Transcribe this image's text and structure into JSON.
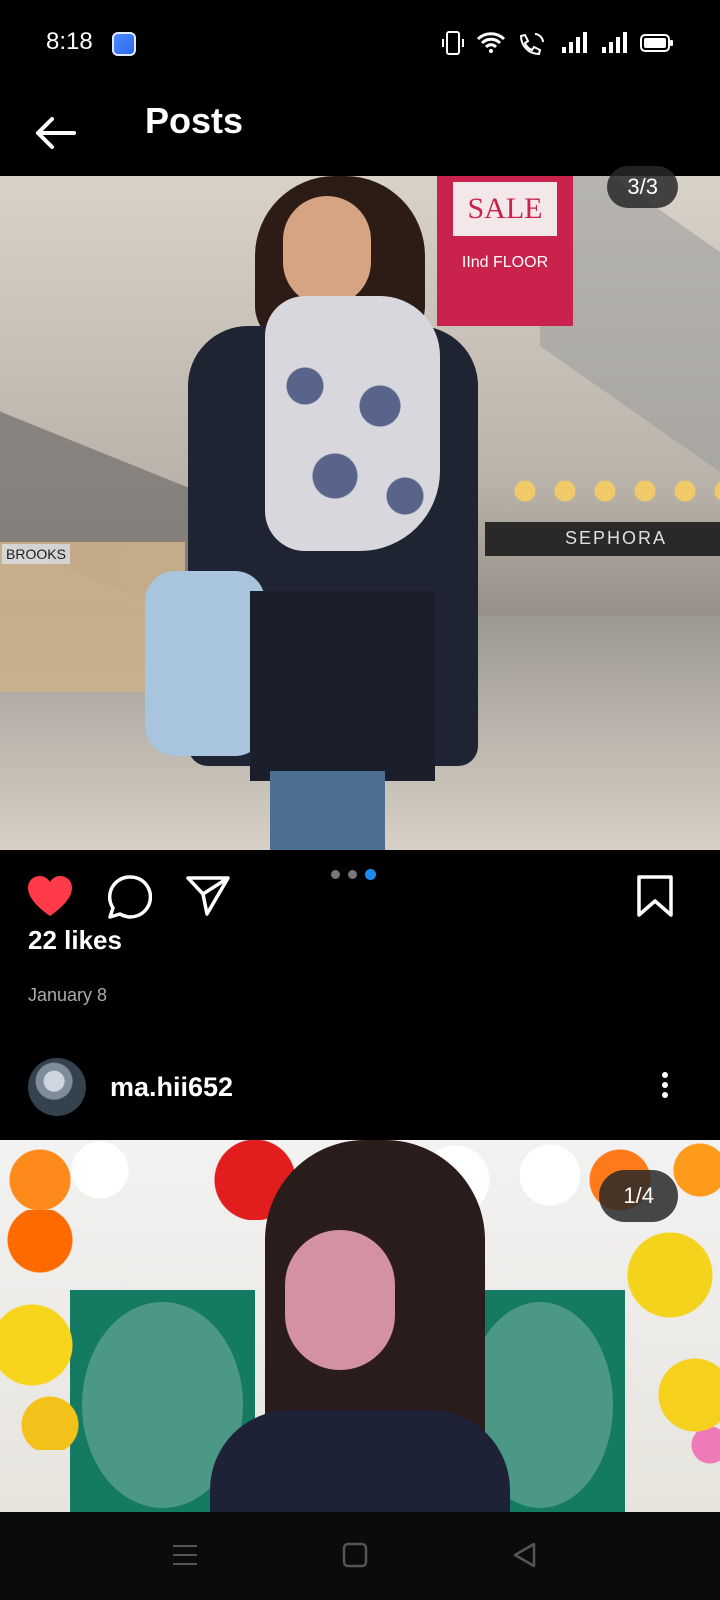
{
  "status_bar": {
    "time": "8:18",
    "icons": [
      "app-notification-icon",
      "vibrate-icon",
      "wifi-icon",
      "wifi-calling-icon",
      "signal-icon-1",
      "signal-icon-2",
      "battery-icon"
    ]
  },
  "header": {
    "back_icon": "arrow-left-icon",
    "title": "Posts"
  },
  "post1": {
    "photo_counter": "3/3",
    "photo_signage": {
      "sale_text": "SALE",
      "floor_text": "IInd FLOOR",
      "store_name_right": "SEPHORA",
      "store_name_left": "BROOKS"
    },
    "actions": {
      "like_icon": "heart-filled-icon",
      "comment_icon": "comment-bubble-icon",
      "share_icon": "send-paper-plane-icon",
      "save_icon": "bookmark-icon"
    },
    "carousel": {
      "total": 3,
      "active_index": 3
    },
    "likes": "22 likes",
    "date": "January 8"
  },
  "post2": {
    "username": "ma.hii652",
    "avatar_icon": "user-avatar",
    "more_icon": "more-vertical-icon",
    "photo_counter": "1/4"
  },
  "navigation_bar": {
    "icons": [
      "menu-icon",
      "home-square-icon",
      "back-triangle-icon"
    ]
  },
  "colors": {
    "background": "#000000",
    "like_red": "#ff3b4a",
    "carousel_active": "#1d8cf0",
    "carousel_inactive": "#777777",
    "secondary_text": "#aaaaaa"
  }
}
